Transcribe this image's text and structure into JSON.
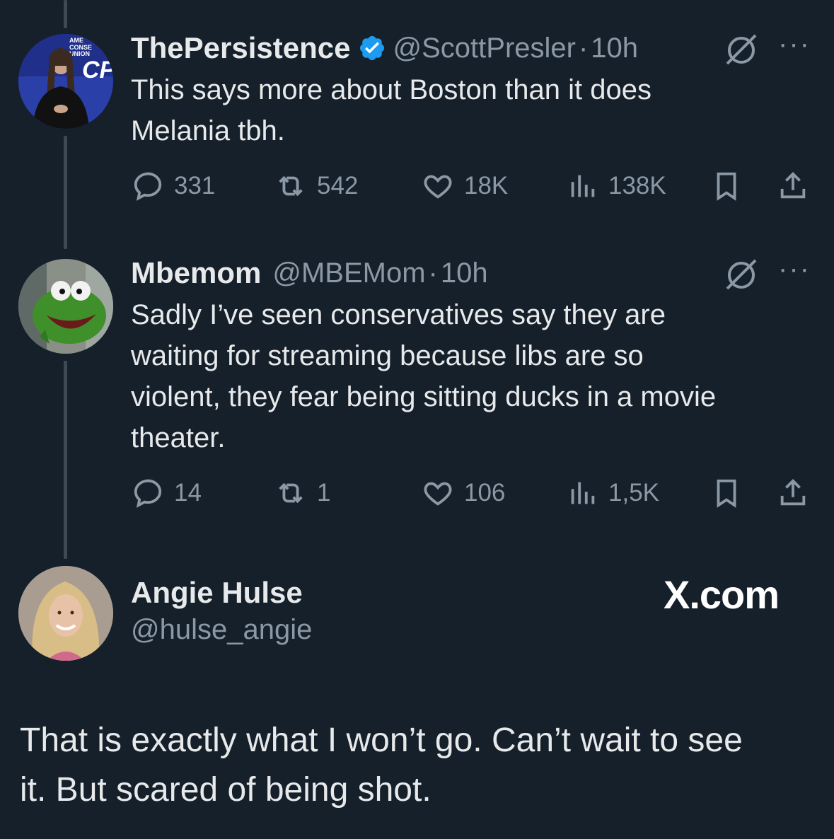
{
  "tweets": [
    {
      "name": "ThePersistence",
      "verified": true,
      "handle": "@ScottPresler",
      "time": "10h",
      "text_lines": [
        "This says more about Boston than it does",
        "Melania tbh."
      ],
      "stats": {
        "replies": "331",
        "reposts": "542",
        "likes": "18K",
        "views": "138K"
      },
      "avatar_badge_lines": [
        "AME",
        "CONSE",
        "UNION",
        "CPA"
      ]
    },
    {
      "name": "Mbemom",
      "handle": "@MBEMom",
      "time": "10h",
      "text_lines": [
        "Sadly I’ve seen conservatives say they are",
        "waiting for streaming because libs are so",
        "violent, they fear being sitting ducks in a movie",
        "theater."
      ],
      "stats": {
        "replies": "14",
        "reposts": "1",
        "likes": "106",
        "views": "1,5K"
      }
    }
  ],
  "quote_card": {
    "name": "Angie Hulse",
    "handle": "@hulse_angie",
    "brand": "X.com",
    "text_lines": [
      "That is exactly what I won’t go. Can’t wait to see",
      "it. But scared of being shot."
    ]
  },
  "colors": {
    "background": "#15202b",
    "text": "#e7e9ea",
    "muted": "#8b98a5",
    "verified": "#1d9bf0",
    "thread_line": "#3d4a56"
  },
  "icons": [
    "verified-badge-icon",
    "grok-icon",
    "more-icon",
    "reply-icon",
    "repost-icon",
    "like-icon",
    "views-icon",
    "bookmark-icon",
    "share-icon"
  ]
}
